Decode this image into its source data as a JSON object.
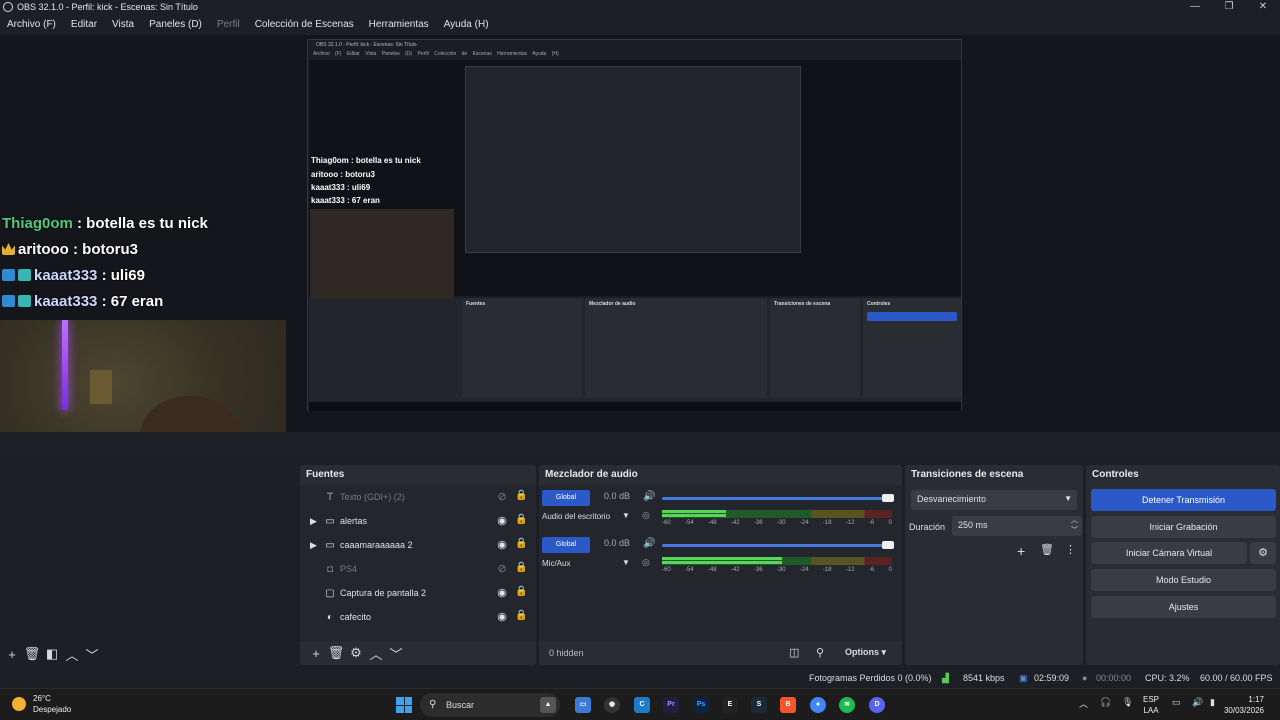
{
  "window": {
    "title": "OBS 32.1.0 - Perfil: kick - Escenas: Sin Título",
    "minimize": "—",
    "maximize": "❐",
    "close": "✕"
  },
  "menu": [
    "Archivo (F)",
    "Editar",
    "Vista",
    "Paneles (D)",
    "Perfil",
    "Colección de Escenas",
    "Herramientas",
    "Ayuda (H)"
  ],
  "preview": {
    "chat": [
      {
        "nick": "Thiag0om",
        "text": " : botella es tu nick"
      },
      {
        "nick": "aritooo",
        "text": " : botoru3"
      },
      {
        "nick": "kaaat333",
        "text": " : uli69"
      },
      {
        "nick": "kaaat333",
        "text": " : 67 eran"
      }
    ],
    "nested": {
      "title": "OBS 32.1.0 - Perfil: kick - Escenas: Sin Título",
      "menu": "Archivo (F)  Editar  Vista  Paneles (D)  Perfil  Colección de Escenas  Herramientas  Ayuda (H)",
      "chat": [
        "Thiag0om : botella es tu nick",
        "aritooo : botoru3",
        "kaaat333 : uli69",
        "kaaat333 : 67 eran"
      ],
      "docks": [
        "Fuentes",
        "Mezclador de audio",
        "Transiciones de escena",
        "Controles"
      ],
      "controls": [
        "Detener Transmisión",
        "Iniciar Grabación",
        "Iniciar Cámara Virtual",
        "Modo Estudio",
        "Ajustes"
      ],
      "sources": [
        "Texto (GDI+) (2)",
        "alertas",
        "caaamaraaaaaa 2",
        "PS4",
        "Captura de pantalla 2",
        "cafecito"
      ],
      "mixer": [
        "Audio del escritorio",
        "Mic/Aux"
      ],
      "transition": "Desvanecimiento",
      "duration_label": "Duración",
      "duration": "250 ms",
      "hidden": "0 hidden",
      "options": "Options",
      "status": "Fotogramas Perdidos 0 (0.0%)   8541 kbps   02:59:09   00:00:00   CPU: 3.2%   60.00 / 60.00 FPS",
      "search": "Buscar",
      "weather": "26°C Despejado",
      "clock": "1:17 30/03/2026"
    }
  },
  "sources": {
    "title": "Fuentes",
    "items": [
      {
        "label": "Texto (GDI+) (2)",
        "icon": "text-icon",
        "visible": false,
        "folder": false
      },
      {
        "label": "alertas",
        "icon": "folder-icon",
        "visible": true,
        "folder": true
      },
      {
        "label": "caaamaraaaaaa 2",
        "icon": "folder-icon",
        "visible": true,
        "folder": true
      },
      {
        "label": "PS4",
        "icon": "camera-icon",
        "visible": false,
        "folder": false
      },
      {
        "label": "Captura de pantalla 2",
        "icon": "monitor-icon",
        "visible": true,
        "folder": false
      },
      {
        "label": "cafecito",
        "icon": "browser-icon",
        "visible": true,
        "folder": false
      }
    ]
  },
  "mixer": {
    "title": "Mezclador de audio",
    "channels": [
      {
        "global": "Global",
        "db": "0.0 dB",
        "name": "Audio del escritorio",
        "volume": 1.0,
        "level": 0.28
      },
      {
        "global": "Global",
        "db": "0.0 dB",
        "name": "Mic/Aux",
        "volume": 1.0,
        "level": 0.52
      }
    ],
    "ticks": [
      "-60",
      "-54",
      "-48",
      "-42",
      "-36",
      "-30",
      "-24",
      "-18",
      "-12",
      "-6",
      "0"
    ],
    "hidden": "0 hidden",
    "options": "Options"
  },
  "transitions": {
    "title": "Transiciones de escena",
    "selected": "Desvanecimiento",
    "duration_label": "Duración",
    "duration": "250 ms"
  },
  "controls": {
    "title": "Controles",
    "stop_stream": "Detener Transmisión",
    "start_recording": "Iniciar Grabación",
    "virtual_cam": "Iniciar Cámara Virtual",
    "studio_mode": "Modo Estudio",
    "settings": "Ajustes"
  },
  "status": {
    "dropped": "Fotogramas Perdidos 0 (0.0%)",
    "bitrate": "8541 kbps",
    "stream_time": "02:59:09",
    "rec_time": "00:00:00",
    "cpu": "CPU: 3.2%",
    "fps": "60.00 / 60.00 FPS"
  },
  "taskbar": {
    "temp": "26°C",
    "weather": "Despejado",
    "search": "Buscar",
    "lang1": "ESP",
    "lang2": "LAA",
    "time": "1:17",
    "date": "30/03/2026"
  },
  "colors": {
    "accent": "#2c59c8",
    "meter_green": "#58d458",
    "chat_nick": "#4fc97b"
  }
}
